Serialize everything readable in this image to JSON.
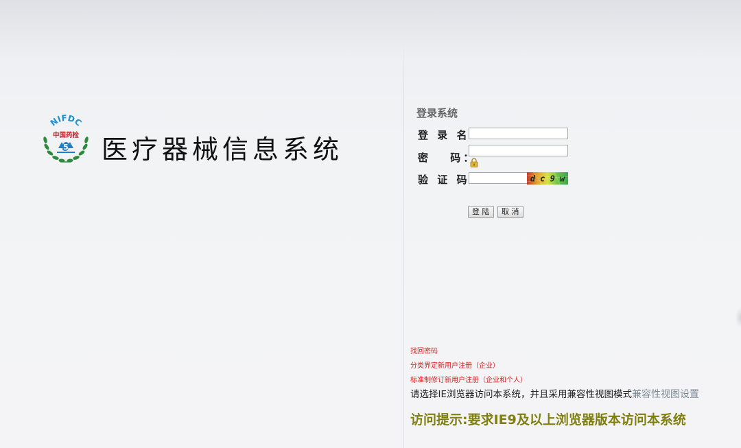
{
  "brand": {
    "logo_text": "NIFDC",
    "logo_subtext": "中国药检",
    "system_title": "医疗器械信息系统"
  },
  "login": {
    "heading": "登录系统",
    "username_label": "登 录 名：",
    "password_label": "密　 码：",
    "captcha_label": "验 证 码：",
    "username_value": "",
    "password_value": "",
    "captcha_value": "",
    "captcha_image_text": "d c 9 w",
    "login_button": "登 陆",
    "cancel_button": "取 消"
  },
  "links": {
    "recover_password": "找回密码",
    "register_enterprise": "分类界定新用户注册（企业）",
    "register_standard": "标准制修订新用户注册（企业和个人）"
  },
  "notes": {
    "ie_note": "请选择IE浏览器访问本系统，并且采用兼容性视图模式",
    "ie_link": "兼容性视图设置",
    "visit_tip": "访问提示:要求IE9及以上浏览器版本访问本系统"
  },
  "colors": {
    "logo_green": "#2e8b3d",
    "logo_blue": "#1e7fc4",
    "logo_red": "#c8202a",
    "link_red": "#d62020",
    "tip_olive": "#7f7f10"
  }
}
